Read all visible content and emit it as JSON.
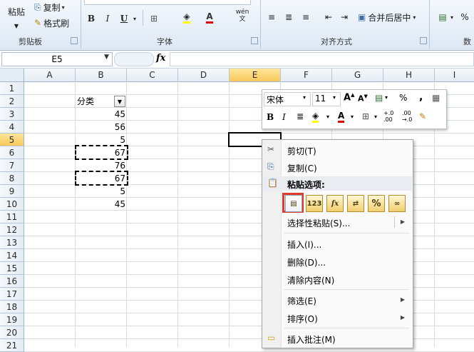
{
  "ribbon": {
    "clipboard": {
      "paste": "粘贴",
      "copy": "复制",
      "format_painter": "格式刷",
      "label": "剪贴板"
    },
    "font": {
      "label": "字体",
      "bold": "B",
      "italic": "I",
      "underline": "U",
      "phonetic": "wén\n文"
    },
    "alignment": {
      "label": "对齐方式",
      "merge": "合并后居中"
    },
    "number": {
      "label": "数",
      "percent": "%"
    }
  },
  "formula_bar": {
    "name_box": "E5",
    "fx": "fx",
    "value": ""
  },
  "sheet": {
    "columns": [
      "A",
      "B",
      "C",
      "D",
      "E",
      "F",
      "G",
      "H",
      "I"
    ],
    "rows": [
      "1",
      "2",
      "3",
      "4",
      "5",
      "6",
      "7",
      "8",
      "9",
      "10",
      "11",
      "12",
      "13",
      "14",
      "15",
      "16",
      "17",
      "18",
      "19",
      "20",
      "21"
    ],
    "active_cell": "E5",
    "b2_header": "分类",
    "b_values": [
      "45",
      "56",
      "5",
      "67",
      "76",
      "67",
      "5",
      "45"
    ]
  },
  "mini_toolbar": {
    "font_name": "宋体",
    "font_size": "11",
    "bold": "B",
    "italic": "I",
    "percent": "%",
    "comma": ",",
    "inc_decimal": "+.0\n.00",
    "dec_decimal": ".00\n→.0"
  },
  "context_menu": {
    "cut": "剪切(T)",
    "copy": "复制(C)",
    "paste_options": "粘贴选项:",
    "paste_special": "选择性粘贴(S)...",
    "insert": "插入(I)...",
    "delete": "删除(D)...",
    "clear": "清除内容(N)",
    "filter": "筛选(E)",
    "sort": "排序(O)",
    "insert_comment": "插入批注(M)",
    "paste_icons": [
      "paste",
      "123",
      "fx",
      "transpose",
      "%",
      "link"
    ]
  },
  "colors": {
    "selected_header": "#f7c85a",
    "highlight_red": "#e03a2f",
    "ribbon": "#dde8f5"
  }
}
